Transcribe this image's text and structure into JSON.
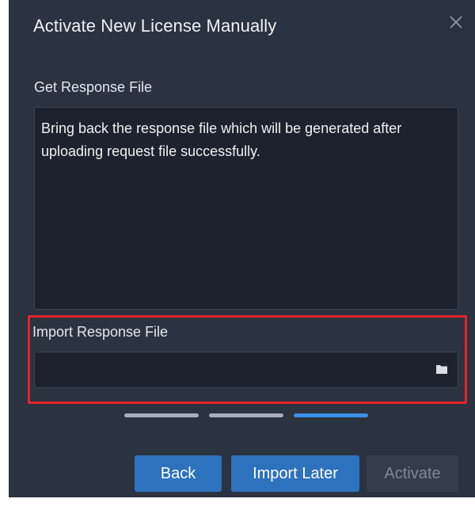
{
  "dialog": {
    "title": "Activate New License Manually",
    "close_icon": "close-icon"
  },
  "get_response": {
    "label": "Get Response File",
    "description": "Bring back the response file which will be generated after uploading request file successfully."
  },
  "import_response": {
    "label": "Import Response File",
    "value": "",
    "placeholder": "",
    "browse_icon": "folder-icon",
    "highlight_color": "#e8232a"
  },
  "steps": {
    "total": 3,
    "current": 3,
    "active_color": "#3a8fe4",
    "inactive_color": "#a9afb8"
  },
  "buttons": {
    "back": "Back",
    "import_later": "Import Later",
    "activate": "Activate"
  },
  "colors": {
    "background": "#2b3240",
    "field": "#1d222c",
    "primary_button": "#2d72bd",
    "disabled_button": "#353d4b"
  }
}
